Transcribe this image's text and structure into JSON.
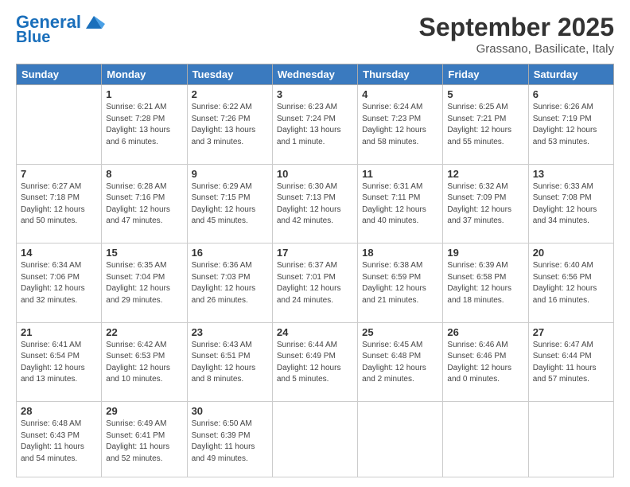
{
  "logo": {
    "line1": "General",
    "line2": "Blue"
  },
  "header": {
    "month": "September 2025",
    "location": "Grassano, Basilicate, Italy"
  },
  "days_header": [
    "Sunday",
    "Monday",
    "Tuesday",
    "Wednesday",
    "Thursday",
    "Friday",
    "Saturday"
  ],
  "weeks": [
    [
      {
        "day": "",
        "info": ""
      },
      {
        "day": "1",
        "info": "Sunrise: 6:21 AM\nSunset: 7:28 PM\nDaylight: 13 hours\nand 6 minutes."
      },
      {
        "day": "2",
        "info": "Sunrise: 6:22 AM\nSunset: 7:26 PM\nDaylight: 13 hours\nand 3 minutes."
      },
      {
        "day": "3",
        "info": "Sunrise: 6:23 AM\nSunset: 7:24 PM\nDaylight: 13 hours\nand 1 minute."
      },
      {
        "day": "4",
        "info": "Sunrise: 6:24 AM\nSunset: 7:23 PM\nDaylight: 12 hours\nand 58 minutes."
      },
      {
        "day": "5",
        "info": "Sunrise: 6:25 AM\nSunset: 7:21 PM\nDaylight: 12 hours\nand 55 minutes."
      },
      {
        "day": "6",
        "info": "Sunrise: 6:26 AM\nSunset: 7:19 PM\nDaylight: 12 hours\nand 53 minutes."
      }
    ],
    [
      {
        "day": "7",
        "info": "Sunrise: 6:27 AM\nSunset: 7:18 PM\nDaylight: 12 hours\nand 50 minutes."
      },
      {
        "day": "8",
        "info": "Sunrise: 6:28 AM\nSunset: 7:16 PM\nDaylight: 12 hours\nand 47 minutes."
      },
      {
        "day": "9",
        "info": "Sunrise: 6:29 AM\nSunset: 7:15 PM\nDaylight: 12 hours\nand 45 minutes."
      },
      {
        "day": "10",
        "info": "Sunrise: 6:30 AM\nSunset: 7:13 PM\nDaylight: 12 hours\nand 42 minutes."
      },
      {
        "day": "11",
        "info": "Sunrise: 6:31 AM\nSunset: 7:11 PM\nDaylight: 12 hours\nand 40 minutes."
      },
      {
        "day": "12",
        "info": "Sunrise: 6:32 AM\nSunset: 7:09 PM\nDaylight: 12 hours\nand 37 minutes."
      },
      {
        "day": "13",
        "info": "Sunrise: 6:33 AM\nSunset: 7:08 PM\nDaylight: 12 hours\nand 34 minutes."
      }
    ],
    [
      {
        "day": "14",
        "info": "Sunrise: 6:34 AM\nSunset: 7:06 PM\nDaylight: 12 hours\nand 32 minutes."
      },
      {
        "day": "15",
        "info": "Sunrise: 6:35 AM\nSunset: 7:04 PM\nDaylight: 12 hours\nand 29 minutes."
      },
      {
        "day": "16",
        "info": "Sunrise: 6:36 AM\nSunset: 7:03 PM\nDaylight: 12 hours\nand 26 minutes."
      },
      {
        "day": "17",
        "info": "Sunrise: 6:37 AM\nSunset: 7:01 PM\nDaylight: 12 hours\nand 24 minutes."
      },
      {
        "day": "18",
        "info": "Sunrise: 6:38 AM\nSunset: 6:59 PM\nDaylight: 12 hours\nand 21 minutes."
      },
      {
        "day": "19",
        "info": "Sunrise: 6:39 AM\nSunset: 6:58 PM\nDaylight: 12 hours\nand 18 minutes."
      },
      {
        "day": "20",
        "info": "Sunrise: 6:40 AM\nSunset: 6:56 PM\nDaylight: 12 hours\nand 16 minutes."
      }
    ],
    [
      {
        "day": "21",
        "info": "Sunrise: 6:41 AM\nSunset: 6:54 PM\nDaylight: 12 hours\nand 13 minutes."
      },
      {
        "day": "22",
        "info": "Sunrise: 6:42 AM\nSunset: 6:53 PM\nDaylight: 12 hours\nand 10 minutes."
      },
      {
        "day": "23",
        "info": "Sunrise: 6:43 AM\nSunset: 6:51 PM\nDaylight: 12 hours\nand 8 minutes."
      },
      {
        "day": "24",
        "info": "Sunrise: 6:44 AM\nSunset: 6:49 PM\nDaylight: 12 hours\nand 5 minutes."
      },
      {
        "day": "25",
        "info": "Sunrise: 6:45 AM\nSunset: 6:48 PM\nDaylight: 12 hours\nand 2 minutes."
      },
      {
        "day": "26",
        "info": "Sunrise: 6:46 AM\nSunset: 6:46 PM\nDaylight: 12 hours\nand 0 minutes."
      },
      {
        "day": "27",
        "info": "Sunrise: 6:47 AM\nSunset: 6:44 PM\nDaylight: 11 hours\nand 57 minutes."
      }
    ],
    [
      {
        "day": "28",
        "info": "Sunrise: 6:48 AM\nSunset: 6:43 PM\nDaylight: 11 hours\nand 54 minutes."
      },
      {
        "day": "29",
        "info": "Sunrise: 6:49 AM\nSunset: 6:41 PM\nDaylight: 11 hours\nand 52 minutes."
      },
      {
        "day": "30",
        "info": "Sunrise: 6:50 AM\nSunset: 6:39 PM\nDaylight: 11 hours\nand 49 minutes."
      },
      {
        "day": "",
        "info": ""
      },
      {
        "day": "",
        "info": ""
      },
      {
        "day": "",
        "info": ""
      },
      {
        "day": "",
        "info": ""
      }
    ]
  ]
}
